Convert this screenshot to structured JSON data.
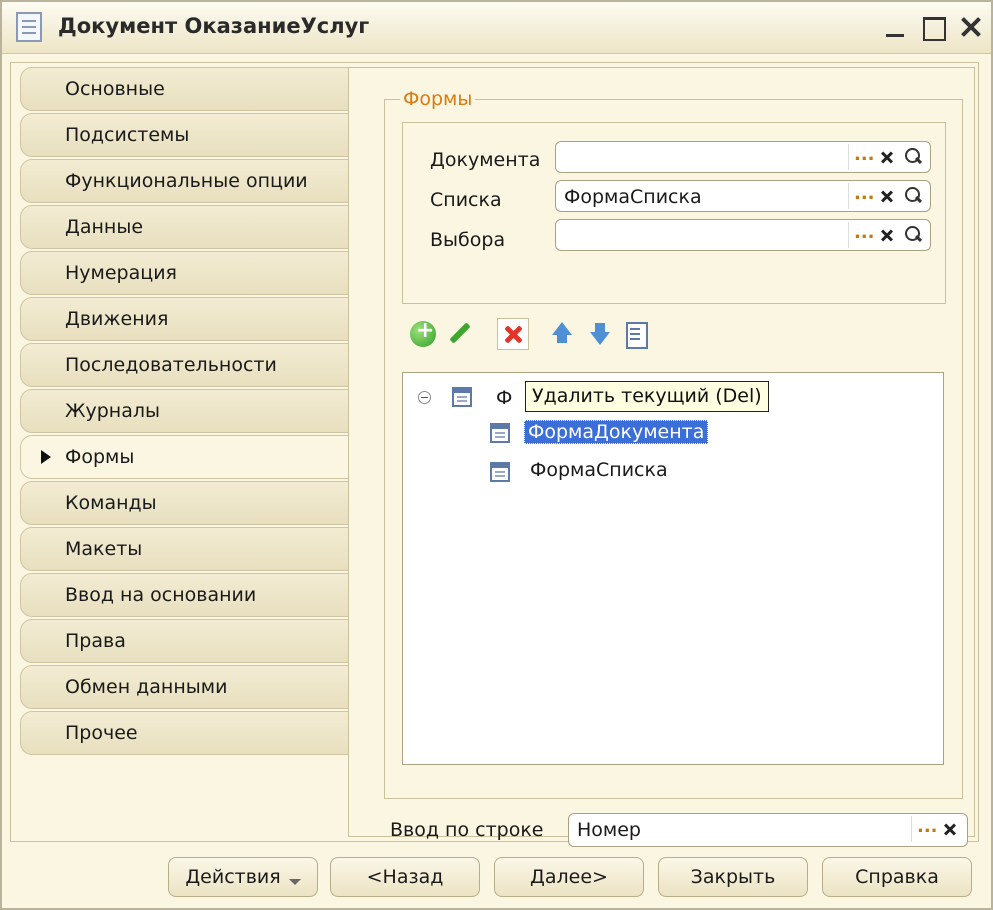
{
  "window": {
    "title": "Документ ОказаниеУслуг",
    "icon": "document-icon"
  },
  "tabs": [
    {
      "label": "Основные"
    },
    {
      "label": "Подсистемы"
    },
    {
      "label": "Функциональные опции"
    },
    {
      "label": "Данные"
    },
    {
      "label": "Нумерация"
    },
    {
      "label": "Движения"
    },
    {
      "label": "Последовательности"
    },
    {
      "label": "Журналы"
    },
    {
      "label": "Формы",
      "active": true
    },
    {
      "label": "Команды"
    },
    {
      "label": "Макеты"
    },
    {
      "label": "Ввод на основании"
    },
    {
      "label": "Права"
    },
    {
      "label": "Обмен данными"
    },
    {
      "label": "Прочее"
    }
  ],
  "forms_group": {
    "legend": "Формы",
    "fields": [
      {
        "label": "Документа",
        "value": ""
      },
      {
        "label": "Списка",
        "value": "ФормаСписка"
      },
      {
        "label": "Выбора",
        "value": ""
      }
    ],
    "field_buttons": [
      "...",
      "clear-icon",
      "search-icon"
    ]
  },
  "toolbar": {
    "buttons": [
      "add-icon",
      "edit-icon",
      "delete-icon",
      "move-up-icon",
      "move-down-icon",
      "list-icon"
    ]
  },
  "tree": {
    "root_label_visible": "Ф",
    "items": [
      {
        "label": "ФормаДокумента",
        "selected": true
      },
      {
        "label": "ФормаСписка"
      }
    ]
  },
  "tooltip": {
    "text": "Удалить текущий (Del)"
  },
  "line_input": {
    "label": "Ввод по строке",
    "value": "Номер"
  },
  "buttons": {
    "actions": "Действия",
    "back": "<Назад",
    "next": "Далее>",
    "close": "Закрыть",
    "help": "Справка"
  },
  "colors": {
    "panel_bg": "#fbf6e1",
    "legend": "#d97b10",
    "selection": "#3b6fd7",
    "tooltip_bg": "#ffffe1"
  }
}
